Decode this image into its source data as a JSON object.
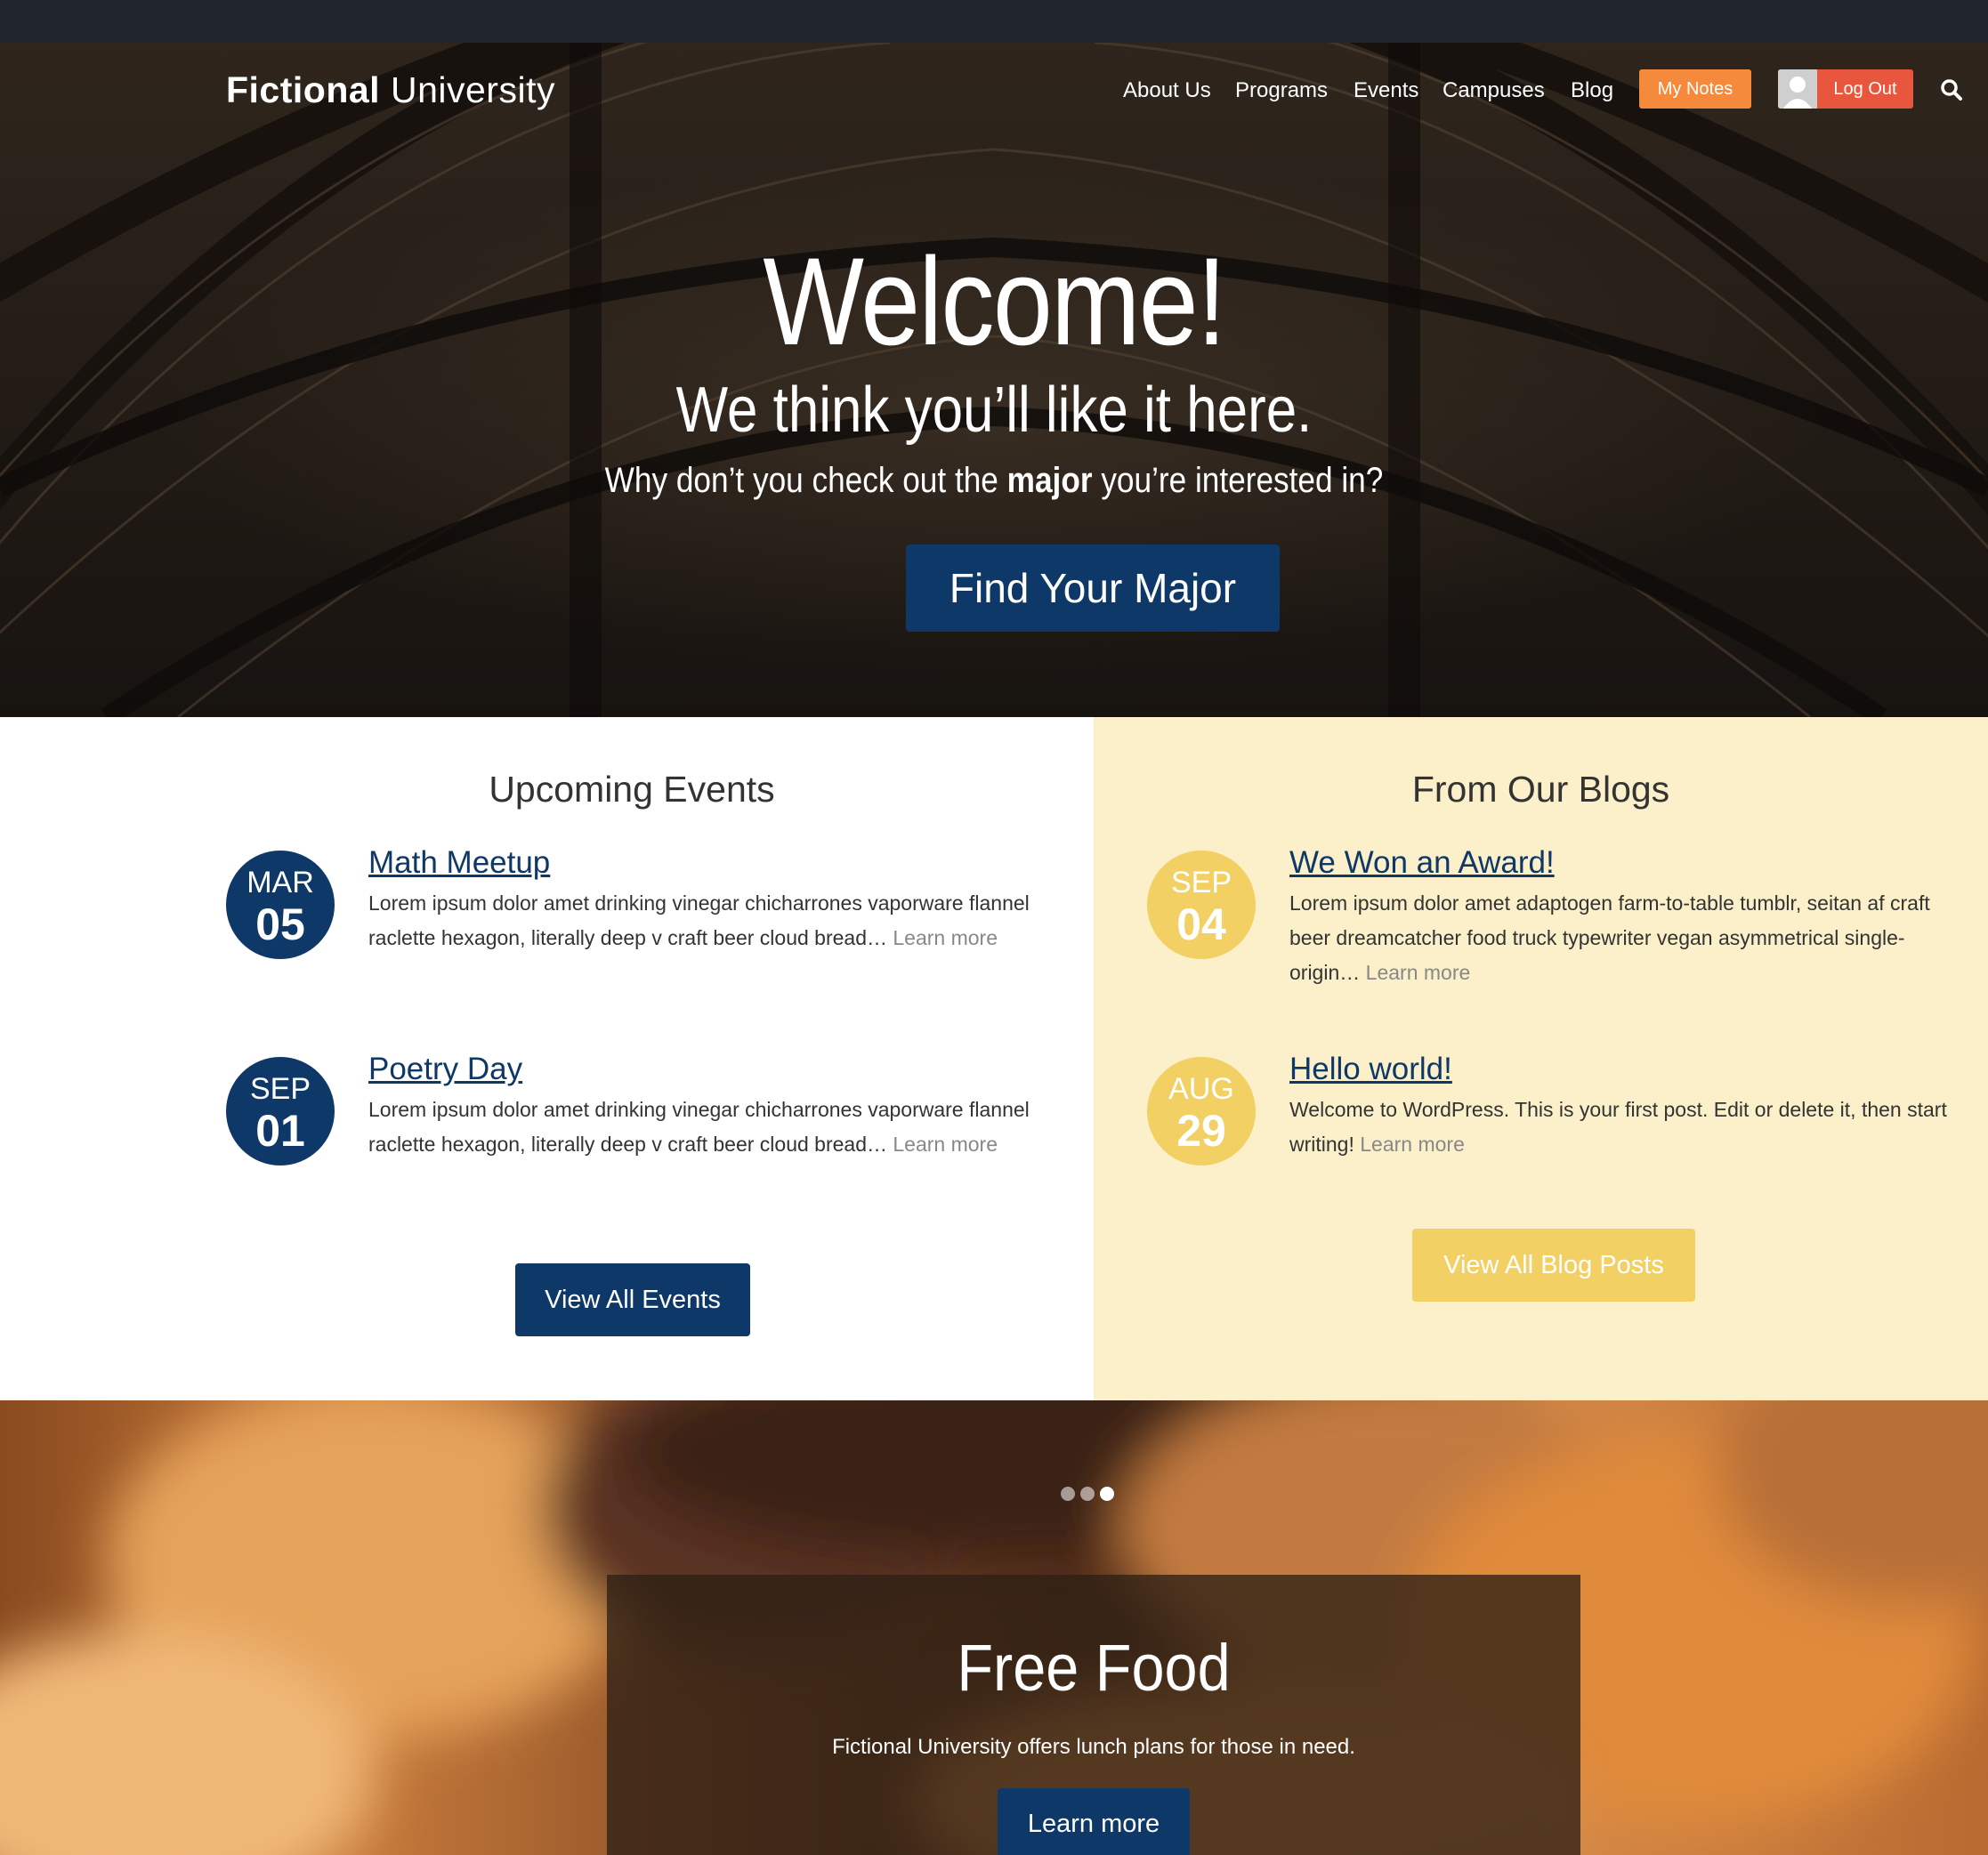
{
  "header": {
    "logo_bold": "Fictional",
    "logo_light": "University",
    "nav": [
      "About Us",
      "Programs",
      "Events",
      "Campuses",
      "Blog"
    ],
    "my_notes": "My Notes",
    "log_out": "Log Out"
  },
  "hero": {
    "title": "Welcome!",
    "subtitle": "We think you’ll like it here.",
    "text_before": "Why don’t you check out the ",
    "text_bold": "major",
    "text_after": " you’re interested in?",
    "button": "Find Your Major"
  },
  "events": {
    "heading": "Upcoming Events",
    "items": [
      {
        "month": "MAR",
        "day": "05",
        "title": "Math Meetup",
        "text": "Lorem ipsum dolor amet drinking vinegar chicharrones vaporware flannel raclette hexagon, literally deep v craft beer cloud bread…",
        "learn": "Learn more"
      },
      {
        "month": "SEP",
        "day": "01",
        "title": "Poetry Day",
        "text": "Lorem ipsum dolor amet drinking vinegar chicharrones vaporware flannel raclette hexagon, literally deep v craft beer cloud bread…",
        "learn": "Learn more"
      }
    ],
    "button": "View All Events"
  },
  "blogs": {
    "heading": "From Our Blogs",
    "items": [
      {
        "month": "SEP",
        "day": "04",
        "title": "We Won an Award!",
        "text": "Lorem ipsum dolor amet adaptogen farm-to-table tumblr, seitan af craft beer dreamcatcher food truck typewriter vegan asymmetrical single-origin…",
        "learn": "Learn more"
      },
      {
        "month": "AUG",
        "day": "29",
        "title": "Hello world!",
        "text": "Welcome to WordPress. This is your first post. Edit or delete it, then start writing!",
        "learn": "Learn more"
      }
    ],
    "button": "View All Blog Posts"
  },
  "slider": {
    "active_slide": 3,
    "total_slides": 3,
    "title": "Free Food",
    "text": "Fictional University offers lunch plans for those in need.",
    "button": "Learn more"
  },
  "colors": {
    "navy": "#0e3867",
    "gold": "#f2d064",
    "orange": "#f58a3c",
    "red": "#e8573d",
    "cream": "#fbf0c9"
  }
}
